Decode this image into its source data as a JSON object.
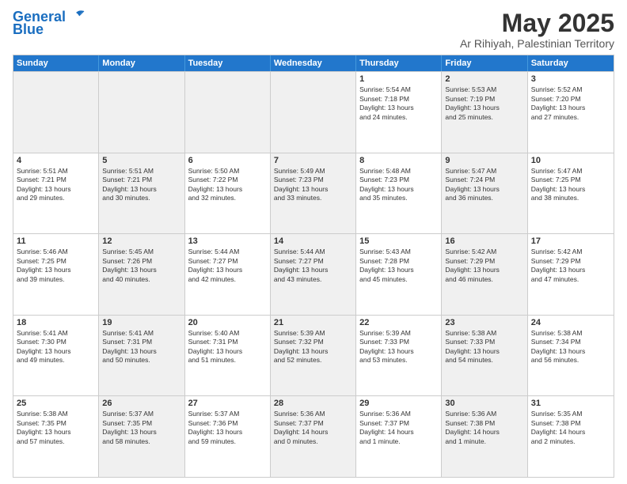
{
  "header": {
    "logo_line1": "General",
    "logo_line2": "Blue",
    "title": "May 2025",
    "subtitle": "Ar Rihiyah, Palestinian Territory"
  },
  "days_of_week": [
    "Sunday",
    "Monday",
    "Tuesday",
    "Wednesday",
    "Thursday",
    "Friday",
    "Saturday"
  ],
  "weeks": [
    [
      {
        "day": "",
        "info": "",
        "shaded": true
      },
      {
        "day": "",
        "info": "",
        "shaded": true
      },
      {
        "day": "",
        "info": "",
        "shaded": true
      },
      {
        "day": "",
        "info": "",
        "shaded": true
      },
      {
        "day": "1",
        "info": "Sunrise: 5:54 AM\nSunset: 7:18 PM\nDaylight: 13 hours\nand 24 minutes."
      },
      {
        "day": "2",
        "info": "Sunrise: 5:53 AM\nSunset: 7:19 PM\nDaylight: 13 hours\nand 25 minutes.",
        "shaded": true
      },
      {
        "day": "3",
        "info": "Sunrise: 5:52 AM\nSunset: 7:20 PM\nDaylight: 13 hours\nand 27 minutes."
      }
    ],
    [
      {
        "day": "4",
        "info": "Sunrise: 5:51 AM\nSunset: 7:21 PM\nDaylight: 13 hours\nand 29 minutes."
      },
      {
        "day": "5",
        "info": "Sunrise: 5:51 AM\nSunset: 7:21 PM\nDaylight: 13 hours\nand 30 minutes.",
        "shaded": true
      },
      {
        "day": "6",
        "info": "Sunrise: 5:50 AM\nSunset: 7:22 PM\nDaylight: 13 hours\nand 32 minutes."
      },
      {
        "day": "7",
        "info": "Sunrise: 5:49 AM\nSunset: 7:23 PM\nDaylight: 13 hours\nand 33 minutes.",
        "shaded": true
      },
      {
        "day": "8",
        "info": "Sunrise: 5:48 AM\nSunset: 7:23 PM\nDaylight: 13 hours\nand 35 minutes."
      },
      {
        "day": "9",
        "info": "Sunrise: 5:47 AM\nSunset: 7:24 PM\nDaylight: 13 hours\nand 36 minutes.",
        "shaded": true
      },
      {
        "day": "10",
        "info": "Sunrise: 5:47 AM\nSunset: 7:25 PM\nDaylight: 13 hours\nand 38 minutes."
      }
    ],
    [
      {
        "day": "11",
        "info": "Sunrise: 5:46 AM\nSunset: 7:25 PM\nDaylight: 13 hours\nand 39 minutes."
      },
      {
        "day": "12",
        "info": "Sunrise: 5:45 AM\nSunset: 7:26 PM\nDaylight: 13 hours\nand 40 minutes.",
        "shaded": true
      },
      {
        "day": "13",
        "info": "Sunrise: 5:44 AM\nSunset: 7:27 PM\nDaylight: 13 hours\nand 42 minutes."
      },
      {
        "day": "14",
        "info": "Sunrise: 5:44 AM\nSunset: 7:27 PM\nDaylight: 13 hours\nand 43 minutes.",
        "shaded": true
      },
      {
        "day": "15",
        "info": "Sunrise: 5:43 AM\nSunset: 7:28 PM\nDaylight: 13 hours\nand 45 minutes."
      },
      {
        "day": "16",
        "info": "Sunrise: 5:42 AM\nSunset: 7:29 PM\nDaylight: 13 hours\nand 46 minutes.",
        "shaded": true
      },
      {
        "day": "17",
        "info": "Sunrise: 5:42 AM\nSunset: 7:29 PM\nDaylight: 13 hours\nand 47 minutes."
      }
    ],
    [
      {
        "day": "18",
        "info": "Sunrise: 5:41 AM\nSunset: 7:30 PM\nDaylight: 13 hours\nand 49 minutes."
      },
      {
        "day": "19",
        "info": "Sunrise: 5:41 AM\nSunset: 7:31 PM\nDaylight: 13 hours\nand 50 minutes.",
        "shaded": true
      },
      {
        "day": "20",
        "info": "Sunrise: 5:40 AM\nSunset: 7:31 PM\nDaylight: 13 hours\nand 51 minutes."
      },
      {
        "day": "21",
        "info": "Sunrise: 5:39 AM\nSunset: 7:32 PM\nDaylight: 13 hours\nand 52 minutes.",
        "shaded": true
      },
      {
        "day": "22",
        "info": "Sunrise: 5:39 AM\nSunset: 7:33 PM\nDaylight: 13 hours\nand 53 minutes."
      },
      {
        "day": "23",
        "info": "Sunrise: 5:38 AM\nSunset: 7:33 PM\nDaylight: 13 hours\nand 54 minutes.",
        "shaded": true
      },
      {
        "day": "24",
        "info": "Sunrise: 5:38 AM\nSunset: 7:34 PM\nDaylight: 13 hours\nand 56 minutes."
      }
    ],
    [
      {
        "day": "25",
        "info": "Sunrise: 5:38 AM\nSunset: 7:35 PM\nDaylight: 13 hours\nand 57 minutes."
      },
      {
        "day": "26",
        "info": "Sunrise: 5:37 AM\nSunset: 7:35 PM\nDaylight: 13 hours\nand 58 minutes.",
        "shaded": true
      },
      {
        "day": "27",
        "info": "Sunrise: 5:37 AM\nSunset: 7:36 PM\nDaylight: 13 hours\nand 59 minutes."
      },
      {
        "day": "28",
        "info": "Sunrise: 5:36 AM\nSunset: 7:37 PM\nDaylight: 14 hours\nand 0 minutes.",
        "shaded": true
      },
      {
        "day": "29",
        "info": "Sunrise: 5:36 AM\nSunset: 7:37 PM\nDaylight: 14 hours\nand 1 minute."
      },
      {
        "day": "30",
        "info": "Sunrise: 5:36 AM\nSunset: 7:38 PM\nDaylight: 14 hours\nand 1 minute.",
        "shaded": true
      },
      {
        "day": "31",
        "info": "Sunrise: 5:35 AM\nSunset: 7:38 PM\nDaylight: 14 hours\nand 2 minutes."
      }
    ]
  ]
}
